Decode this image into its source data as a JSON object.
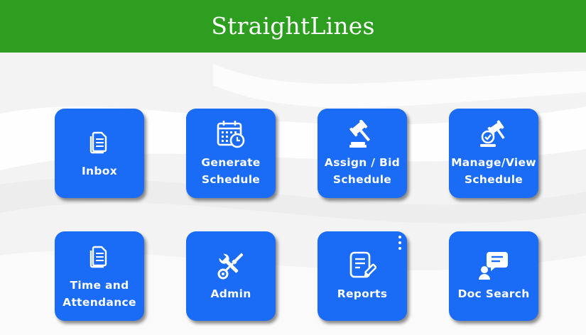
{
  "app": {
    "title": "StraightLines"
  },
  "colors": {
    "header_bg": "#2d9e1f",
    "tile_bg": "#1a6bf5",
    "text": "#ffffff"
  },
  "tiles": [
    {
      "label": "Inbox",
      "icon": "documents-icon"
    },
    {
      "label": "Generate\nSchedule",
      "icon": "calendar-clock-icon"
    },
    {
      "label": "Assign / Bid\nSchedule",
      "icon": "gavel-icon"
    },
    {
      "label": "Manage/View\nSchedule",
      "icon": "gavel-check-icon"
    },
    {
      "label": "Time and\nAttendance",
      "icon": "documents-icon"
    },
    {
      "label": "Admin",
      "icon": "tools-icon"
    },
    {
      "label": "Reports",
      "icon": "report-edit-icon"
    },
    {
      "label": "Doc Search",
      "icon": "user-chat-icon"
    }
  ]
}
